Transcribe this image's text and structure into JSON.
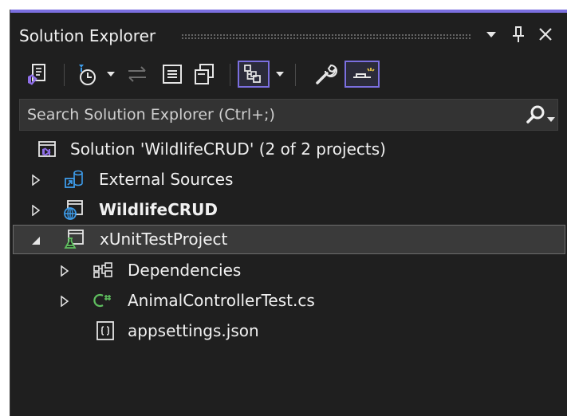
{
  "panel": {
    "title": "Solution Explorer",
    "accent_color": "#7b6fe0"
  },
  "title_buttons": [
    {
      "name": "window-position-dropdown",
      "icon": "chevron-down-icon"
    },
    {
      "name": "pin",
      "icon": "pin-icon"
    },
    {
      "name": "close",
      "icon": "close-icon"
    }
  ],
  "toolbar": {
    "items": [
      {
        "name": "switch-views",
        "icon": "switch-views-icon"
      },
      {
        "name": "pending-changes-filter",
        "icon": "pending-changes-clock-icon"
      },
      {
        "name": "sync-with-active-document",
        "icon": "sync-arrows-icon"
      },
      {
        "name": "collapse-all",
        "icon": "collapse-all-icon"
      },
      {
        "name": "show-all-files",
        "icon": "show-all-files-icon"
      },
      {
        "name": "file-nesting",
        "icon": "tree-hierarchy-icon",
        "active": true
      },
      {
        "name": "properties",
        "icon": "wrench-icon"
      },
      {
        "name": "preview-selected-items",
        "icon": "preview-icon",
        "active": true
      }
    ]
  },
  "search": {
    "placeholder": "Search Solution Explorer (Ctrl+;)",
    "value": ""
  },
  "tree": [
    {
      "label": "Solution 'WildlifeCRUD' (2 of 2 projects)",
      "icon": "solution-icon",
      "level": 0,
      "expander": "none",
      "bold": false,
      "selected": false
    },
    {
      "label": "External Sources",
      "icon": "external-sources-icon",
      "level": 1,
      "expander": "collapsed",
      "bold": false,
      "selected": false
    },
    {
      "label": "WildlifeCRUD",
      "icon": "web-project-icon",
      "level": 1,
      "expander": "collapsed",
      "bold": true,
      "selected": false
    },
    {
      "label": "xUnitTestProject",
      "icon": "test-project-icon",
      "level": 1,
      "expander": "expanded",
      "bold": false,
      "selected": true
    },
    {
      "label": "Dependencies",
      "icon": "dependencies-icon",
      "level": 2,
      "expander": "collapsed",
      "bold": false,
      "selected": false
    },
    {
      "label": "AnimalControllerTest.cs",
      "icon": "csharp-file-icon",
      "level": 2,
      "expander": "collapsed",
      "bold": false,
      "selected": false
    },
    {
      "label": "appsettings.json",
      "icon": "json-file-icon",
      "level": 2,
      "expander": "none",
      "bold": false,
      "selected": false
    }
  ]
}
